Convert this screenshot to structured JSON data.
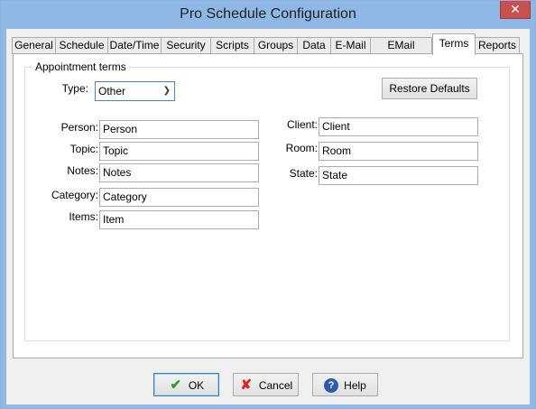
{
  "window": {
    "title": "Pro Schedule Configuration",
    "close_glyph": "✕"
  },
  "tabs": [
    {
      "label": "General"
    },
    {
      "label": "Schedule"
    },
    {
      "label": "Date/Time"
    },
    {
      "label": "Security"
    },
    {
      "label": "Scripts"
    },
    {
      "label": "Groups"
    },
    {
      "label": "Data"
    },
    {
      "label": "E-Mail"
    },
    {
      "label": "EMail Scripts"
    },
    {
      "label": "Terms"
    },
    {
      "label": "Reports"
    }
  ],
  "active_tab": "Terms",
  "group": {
    "label": "Appointment terms"
  },
  "type": {
    "label": "Type:",
    "value": "Other"
  },
  "restore_button": {
    "label": "Restore Defaults"
  },
  "left_fields": [
    {
      "label": "Person:",
      "value": "Person"
    },
    {
      "label": "Topic:",
      "value": "Topic"
    },
    {
      "label": "Notes:",
      "value": "Notes"
    },
    {
      "label": "Category:",
      "value": "Category"
    },
    {
      "label": "Items:",
      "value": "Item"
    }
  ],
  "right_fields": [
    {
      "label": "Client:",
      "value": "Client"
    },
    {
      "label": "Room:",
      "value": "Room"
    },
    {
      "label": "State:",
      "value": "State"
    }
  ],
  "footer": {
    "ok": {
      "label": "OK",
      "icon": "checkmark-icon"
    },
    "cancel": {
      "label": "Cancel",
      "icon": "x-icon"
    },
    "help": {
      "label": "Help",
      "icon": "question-icon"
    }
  }
}
